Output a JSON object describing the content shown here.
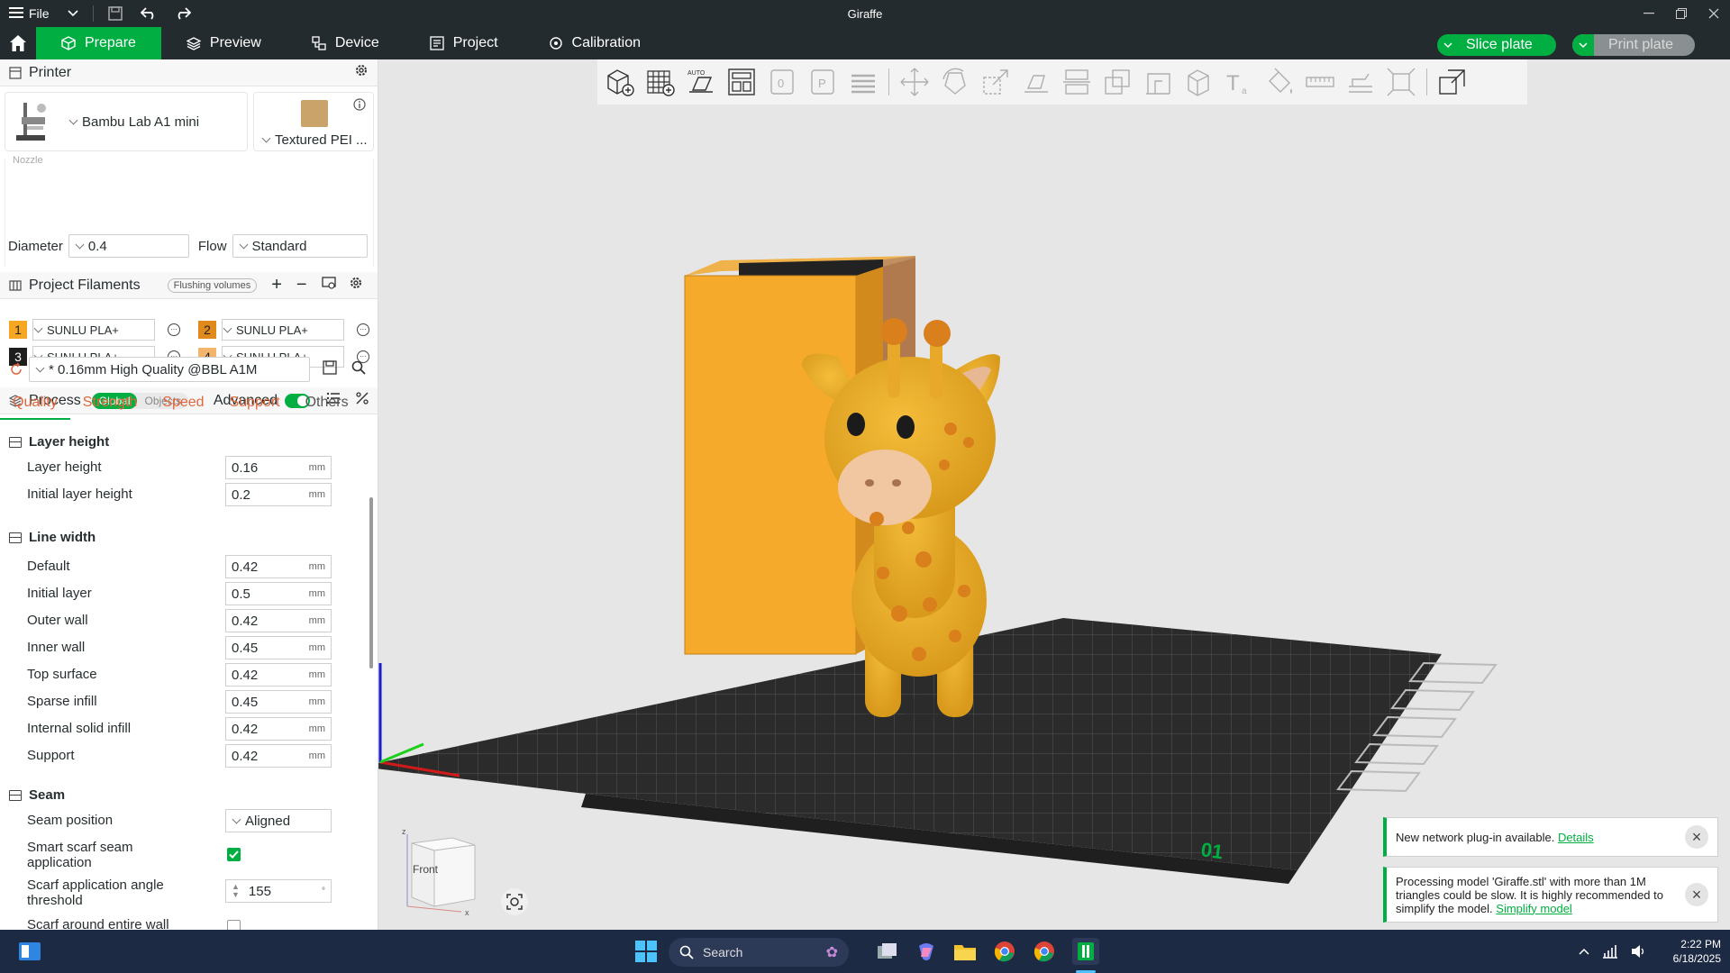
{
  "window": {
    "title": "Giraffe",
    "file_label": "File"
  },
  "tabs": [
    {
      "label": "Prepare"
    },
    {
      "label": "Preview"
    },
    {
      "label": "Device"
    },
    {
      "label": "Project"
    },
    {
      "label": "Calibration"
    }
  ],
  "actions": {
    "slice_label": "Slice plate",
    "print_label": "Print plate"
  },
  "printer": {
    "section_label": "Printer",
    "model": "Bambu Lab A1 mini",
    "plate": "Textured PEI ...",
    "nozzle_label": "Nozzle",
    "diameter_label": "Diameter",
    "diameter_value": "0.4",
    "flow_label": "Flow",
    "flow_value": "Standard"
  },
  "filaments": {
    "section_label": "Project Filaments",
    "flushing_label": "Flushing volumes",
    "items": [
      {
        "num": "1",
        "name": "SUNLU PLA+",
        "color": "#f5a623"
      },
      {
        "num": "2",
        "name": "SUNLU PLA+",
        "color": "#e08a1e"
      },
      {
        "num": "3",
        "name": "SUNLU PLA+",
        "color": "#1e1e1e"
      },
      {
        "num": "4",
        "name": "SUNLU PLA+",
        "color": "#f2b56b"
      }
    ]
  },
  "process": {
    "section_label": "Process",
    "global_label": "Global",
    "objects_label": "Objects",
    "advanced_label": "Advanced",
    "preset": "* 0.16mm High Quality @BBL A1M",
    "tabs": [
      "Quality",
      "Strength",
      "Speed",
      "Support",
      "Others"
    ]
  },
  "quality": {
    "layer_height_group": "Layer height",
    "layer_height_label": "Layer height",
    "layer_height_value": "0.16",
    "initial_layer_height_label": "Initial layer height",
    "initial_layer_height_value": "0.2",
    "line_width_group": "Line width",
    "line_widths": [
      {
        "label": "Default",
        "value": "0.42"
      },
      {
        "label": "Initial layer",
        "value": "0.5"
      },
      {
        "label": "Outer wall",
        "value": "0.42"
      },
      {
        "label": "Inner wall",
        "value": "0.45"
      },
      {
        "label": "Top surface",
        "value": "0.42"
      },
      {
        "label": "Sparse infill",
        "value": "0.45"
      },
      {
        "label": "Internal solid infill",
        "value": "0.42"
      },
      {
        "label": "Support",
        "value": "0.42"
      }
    ],
    "unit": "mm",
    "seam_group": "Seam",
    "seam_position_label": "Seam position",
    "seam_position_value": "Aligned",
    "smart_scarf_label": "Smart scarf seam application",
    "smart_scarf_checked": true,
    "scarf_angle_label": "Scarf application angle threshold",
    "scarf_angle_value": "155",
    "scarf_around_label": "Scarf around entire wall"
  },
  "viewport": {
    "cube_label": "Front",
    "plate_number": "01"
  },
  "notifications": [
    {
      "text": "New network plug-in available.",
      "link": "Details"
    },
    {
      "text": "Processing model 'Giraffe.stl' with more than 1M triangles could be slow. It is highly recommended to simplify the model.",
      "link": "Simplify model"
    }
  ],
  "taskbar": {
    "search_label": "Search",
    "time": "2:22 PM",
    "date": "6/18/2025"
  }
}
